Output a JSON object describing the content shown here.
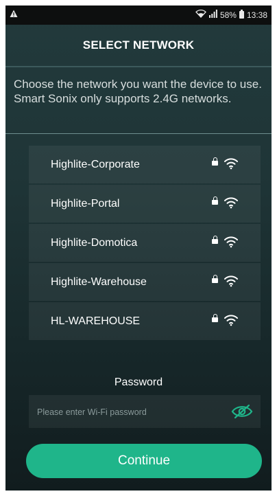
{
  "status_bar": {
    "alert_icon": "warning-icon",
    "battery": "58%",
    "time": "13:38"
  },
  "header": {
    "title": "SELECT NETWORK"
  },
  "description": "Choose the network you want the device to use. Smart Sonix only supports 2.4G networks.",
  "networks": [
    {
      "name": "Highlite-Corporate",
      "icons": [
        "lock-icon",
        "wifi-icon"
      ]
    },
    {
      "name": "Highlite-Portal",
      "icons": [
        "lock-icon",
        "wifi-icon"
      ]
    },
    {
      "name": "Highlite-Domotica",
      "icons": [
        "lock-icon",
        "wifi-icon"
      ]
    },
    {
      "name": "Highlite-Warehouse",
      "icons": [
        "lock-icon",
        "wifi-icon"
      ]
    },
    {
      "name": "HL-WAREHOUSE",
      "icons": [
        "lock-icon",
        "wifi-icon"
      ]
    }
  ],
  "password": {
    "label": "Password",
    "value": "",
    "placeholder": "Please enter Wi-Fi password",
    "toggle_icon": "eye-slash-icon"
  },
  "continue_label": "Continue",
  "colors": {
    "accent": "#1fb58a",
    "eye_icon": "#1fb58a",
    "background_top": "#223a3c",
    "background_bottom": "#111c1e"
  }
}
